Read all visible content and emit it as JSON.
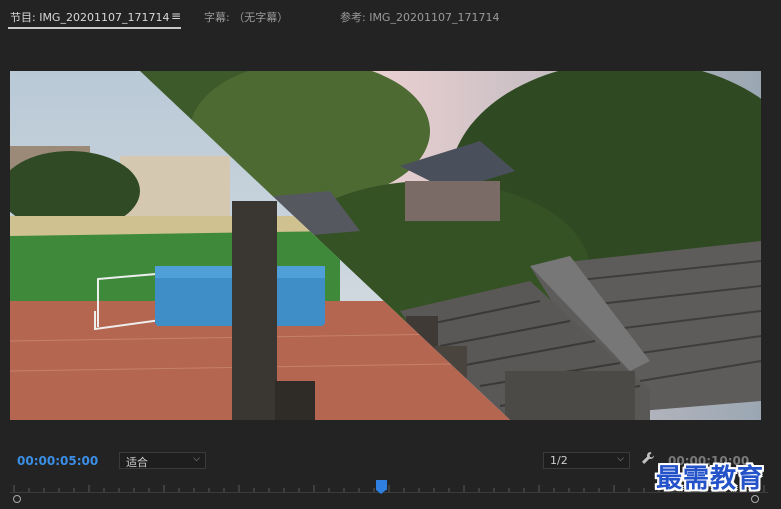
{
  "tabs": {
    "program": "节目: IMG_20201107_171714",
    "program_menu": "≡",
    "captions": "字幕: （无字幕）",
    "reference": "参考: IMG_20201107_171714"
  },
  "viewer": {
    "description_icon": "video-frame",
    "transition": "diagonal wipe"
  },
  "controls": {
    "current_timecode": "00:00:05:00",
    "fit_value": "适合",
    "resolution_value": "1/2",
    "duration": "00:00:10:00",
    "chevron": "⌵",
    "wrench_glyph": "🔧"
  },
  "timeline": {
    "progress": 0.5
  },
  "watermark": "最需教育",
  "colors": {
    "accent": "#3a8ee6",
    "playhead": "#2f7fe0"
  }
}
